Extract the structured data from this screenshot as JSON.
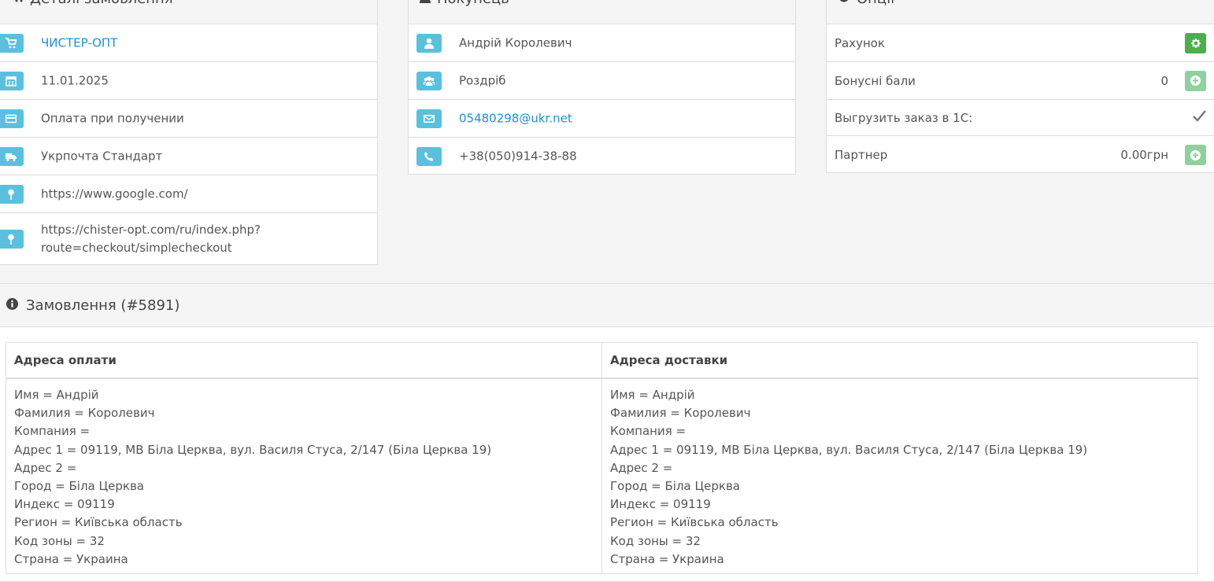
{
  "order_details": {
    "title": "Деталі замовлення",
    "rows": [
      {
        "icon": "shopping-cart-icon",
        "text": "ЧИСТЕР-ОПТ",
        "link": true
      },
      {
        "icon": "calendar-icon",
        "text": "11.01.2025"
      },
      {
        "icon": "credit-card-icon",
        "text": "Оплата при получении"
      },
      {
        "icon": "truck-icon",
        "text": "Укрпочта Стандарт"
      },
      {
        "icon": "map-pin-icon",
        "text": "https://www.google.com/"
      },
      {
        "icon": "map-pin-icon",
        "text": "https://chister-opt.com/ru/index.php? route=checkout/simplecheckout"
      }
    ]
  },
  "customer": {
    "title": "Покупець",
    "rows": [
      {
        "icon": "user-icon",
        "text": "Андрій Королевич"
      },
      {
        "icon": "users-icon",
        "text": "Роздріб"
      },
      {
        "icon": "envelope-icon",
        "text": "05480298@ukr.net",
        "link": true
      },
      {
        "icon": "phone-icon",
        "text": "+38(050)914-38-88"
      }
    ]
  },
  "options": {
    "title": "Опції",
    "invoice_label": "Рахунок",
    "bonus_label": "Бонусні бали",
    "bonus_value": "0",
    "export_label": "Выгрузить заказ в 1С:",
    "export_checked": true,
    "partner_label": "Партнер",
    "partner_value": "0.00грн"
  },
  "order": {
    "title": "Замовлення (#5891)",
    "billing_header": "Адреса оплати",
    "shipping_header": "Адреса доставки",
    "billing_lines": [
      "Имя = Андрій",
      "Фамилия = Королевич",
      "Компания =",
      "Адрес 1 = 09119, МВ Біла Церква, вул. Василя Стуса, 2/147 (Біла Церква 19)",
      "Адрес 2 =",
      "Город = Біла Церква",
      "Индекс = 09119",
      "Регион = Київська область",
      "Код зоны = 32",
      "Страна = Украина"
    ],
    "shipping_lines": [
      "Имя = Андрій",
      "Фамилия = Королевич",
      "Компания =",
      "Адрес 1 = 09119, МВ Біла Церква, вул. Василя Стуса, 2/147 (Біла Церква 19)",
      "Адрес 2 =",
      "Город = Біла Церква",
      "Индекс = 09119",
      "Регион = Київська область",
      "Код зоны = 32",
      "Страна = Украина"
    ]
  }
}
